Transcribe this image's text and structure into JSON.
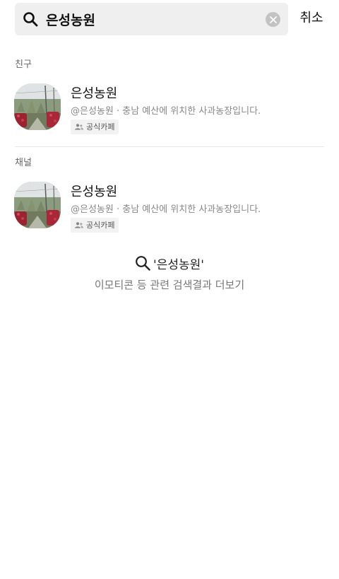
{
  "search": {
    "query": "은성농원",
    "cancel_label": "취소"
  },
  "sections": {
    "friends_label": "친구",
    "channels_label": "채널"
  },
  "friends": [
    {
      "name": "은성농원",
      "description": "@은성농원 · 충남 예산에 위치한 사과농장입니다.",
      "badge": "공식카페"
    }
  ],
  "channels": [
    {
      "name": "은성농원",
      "description": "@은성농원 · 충남 예산에 위치한 사과농장입니다.",
      "badge": "공식카페"
    }
  ],
  "more": {
    "query_label": "'은성농원'",
    "description": "이모티콘 등 관련 검색결과 더보기"
  },
  "icons": {
    "search": "search-icon",
    "clear": "clear-icon",
    "badge": "people-icon"
  }
}
